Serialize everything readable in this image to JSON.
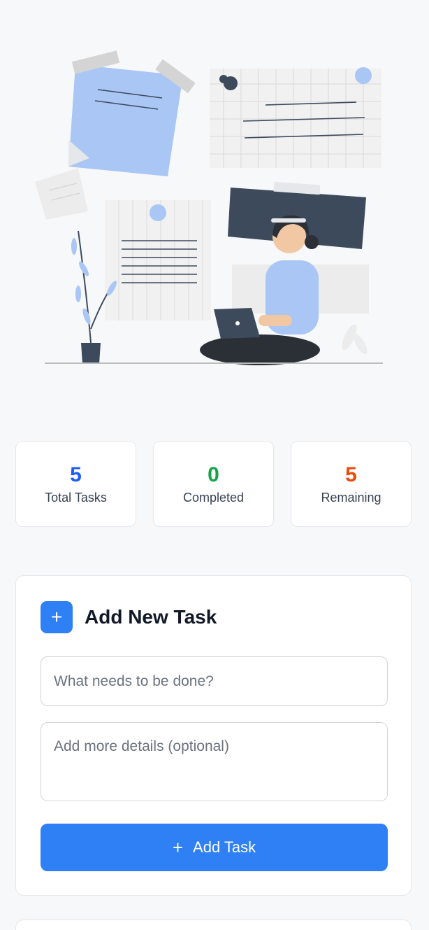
{
  "stats": [
    {
      "value": "5",
      "label": "Total Tasks",
      "color": "#1d5cf5"
    },
    {
      "value": "0",
      "label": "Completed",
      "color": "#16a34a"
    },
    {
      "value": "5",
      "label": "Remaining",
      "color": "#ea4a0c"
    }
  ],
  "add_task": {
    "icon": "plus-icon",
    "title": "Add New Task",
    "title_placeholder": "What needs to be done?",
    "title_value": "",
    "description_placeholder": "Add more details (optional)",
    "description_value": "",
    "button_label": "Add Task",
    "button_icon": "plus-icon",
    "accent": "#2f7ff5"
  }
}
